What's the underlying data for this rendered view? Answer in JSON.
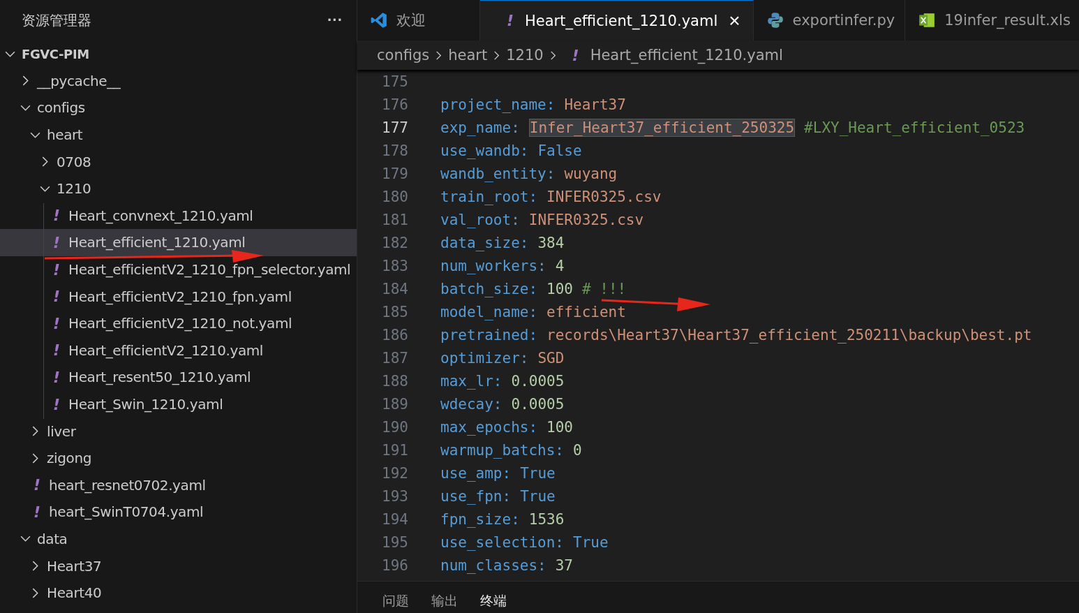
{
  "sidebar": {
    "title": "资源管理器",
    "more": "···",
    "tree": [
      {
        "label": "FGVC-PIM",
        "kind": "root",
        "expanded": true,
        "selected": false,
        "children": [
          {
            "label": "__pycache__",
            "kind": "folder",
            "expanded": false,
            "selected": false
          },
          {
            "label": "configs",
            "kind": "folder",
            "expanded": true,
            "selected": false,
            "children": [
              {
                "label": "heart",
                "kind": "folder",
                "expanded": true,
                "selected": false,
                "children": [
                  {
                    "label": "0708",
                    "kind": "folder",
                    "expanded": false,
                    "selected": false
                  },
                  {
                    "label": "1210",
                    "kind": "folder",
                    "expanded": true,
                    "selected": false,
                    "children": [
                      {
                        "label": "Heart_convnext_1210.yaml",
                        "kind": "file",
                        "icon": "!",
                        "selected": false
                      },
                      {
                        "label": "Heart_efficient_1210.yaml",
                        "kind": "file",
                        "icon": "!",
                        "selected": true
                      },
                      {
                        "label": "Heart_efficientV2_1210_fpn_selector.yaml",
                        "kind": "file",
                        "icon": "!",
                        "selected": false
                      },
                      {
                        "label": "Heart_efficientV2_1210_fpn.yaml",
                        "kind": "file",
                        "icon": "!",
                        "selected": false
                      },
                      {
                        "label": "Heart_efficientV2_1210_not.yaml",
                        "kind": "file",
                        "icon": "!",
                        "selected": false
                      },
                      {
                        "label": "Heart_efficientV2_1210.yaml",
                        "kind": "file",
                        "icon": "!",
                        "selected": false
                      },
                      {
                        "label": "Heart_resent50_1210.yaml",
                        "kind": "file",
                        "icon": "!",
                        "selected": false
                      },
                      {
                        "label": "Heart_Swin_1210.yaml",
                        "kind": "file",
                        "icon": "!",
                        "selected": false
                      }
                    ]
                  }
                ]
              },
              {
                "label": "liver",
                "kind": "folder",
                "expanded": false,
                "selected": false
              },
              {
                "label": "zigong",
                "kind": "folder",
                "expanded": false,
                "selected": false
              },
              {
                "label": "heart_resnet0702.yaml",
                "kind": "file",
                "icon": "!",
                "selected": false
              },
              {
                "label": "heart_SwinT0704.yaml",
                "kind": "file",
                "icon": "!",
                "selected": false
              }
            ]
          },
          {
            "label": "data",
            "kind": "folder",
            "expanded": true,
            "selected": false,
            "children": [
              {
                "label": "Heart37",
                "kind": "folder",
                "expanded": false,
                "selected": false
              },
              {
                "label": "Heart40",
                "kind": "folder",
                "expanded": false,
                "selected": false
              }
            ]
          }
        ]
      }
    ]
  },
  "tabs": [
    {
      "label": "欢迎",
      "kind": "vscode",
      "selected": false
    },
    {
      "label": "Heart_efficient_1210.yaml",
      "kind": "yaml",
      "icon": "!",
      "selected": true,
      "close": "×"
    },
    {
      "label": "exportinfer.py",
      "kind": "python",
      "selected": false
    },
    {
      "label": "19infer_result.xls",
      "kind": "excel",
      "selected": false
    }
  ],
  "breadcrumb": [
    {
      "label": "configs"
    },
    {
      "label": "heart"
    },
    {
      "label": "1210"
    },
    {
      "label": "Heart_efficient_1210.yaml",
      "icon": "!"
    }
  ],
  "editor": {
    "lines": [
      {
        "number": "175",
        "selected": false
      },
      {
        "number": "176",
        "key": "project_name:",
        "value": "Heart37",
        "kind": "string",
        "selected": false
      },
      {
        "number": "177",
        "key": "exp_name:",
        "value": "Infer_Heart37_efficient_250325",
        "kind": "string",
        "comment": "#LXY_Heart_efficient_0523",
        "selected": true
      },
      {
        "number": "178",
        "key": "use_wandb:",
        "value": "False",
        "kind": "boolean",
        "selected": false
      },
      {
        "number": "179",
        "key": "wandb_entity:",
        "value": "wuyang",
        "kind": "string",
        "selected": false
      },
      {
        "number": "180",
        "key": "train_root:",
        "value": "INFER0325.csv",
        "kind": "string",
        "selected": false
      },
      {
        "number": "181",
        "key": "val_root:",
        "value": "INFER0325.csv",
        "kind": "string",
        "selected": false
      },
      {
        "number": "182",
        "key": "data_size:",
        "value": "384",
        "kind": "number",
        "selected": false
      },
      {
        "number": "183",
        "key": "num_workers:",
        "value": "4",
        "kind": "number",
        "selected": false
      },
      {
        "number": "184",
        "key": "batch_size:",
        "value": "100",
        "kind": "number",
        "comment": "# !!!",
        "selected": false
      },
      {
        "number": "185",
        "key": "model_name:",
        "value": "efficient",
        "kind": "string",
        "selected": false
      },
      {
        "number": "186",
        "key": "pretrained:",
        "value": "records\\Heart37\\Heart37_efficient_250211\\backup\\best.pt",
        "kind": "string",
        "selected": false
      },
      {
        "number": "187",
        "key": "optimizer:",
        "value": "SGD",
        "kind": "string",
        "selected": false
      },
      {
        "number": "188",
        "key": "max_lr:",
        "value": "0.0005",
        "kind": "number",
        "selected": false
      },
      {
        "number": "189",
        "key": "wdecay:",
        "value": "0.0005",
        "kind": "number",
        "selected": false
      },
      {
        "number": "190",
        "key": "max_epochs:",
        "value": "100",
        "kind": "number",
        "selected": false
      },
      {
        "number": "191",
        "key": "warmup_batchs:",
        "value": "0",
        "kind": "number",
        "selected": false
      },
      {
        "number": "192",
        "key": "use_amp:",
        "value": "True",
        "kind": "boolean",
        "selected": false
      },
      {
        "number": "193",
        "key": "use_fpn:",
        "value": "True",
        "kind": "boolean",
        "selected": false
      },
      {
        "number": "194",
        "key": "fpn_size:",
        "value": "1536",
        "kind": "number",
        "selected": false
      },
      {
        "number": "195",
        "key": "use_selection:",
        "value": "True",
        "kind": "boolean",
        "selected": false
      },
      {
        "number": "196",
        "key": "num_classes:",
        "value": "37",
        "kind": "number",
        "selected": false
      }
    ]
  },
  "panel": {
    "tabs": [
      {
        "label": "问题",
        "selected": false
      },
      {
        "label": "输出",
        "selected": false
      },
      {
        "label": "终端",
        "selected": true
      }
    ]
  }
}
